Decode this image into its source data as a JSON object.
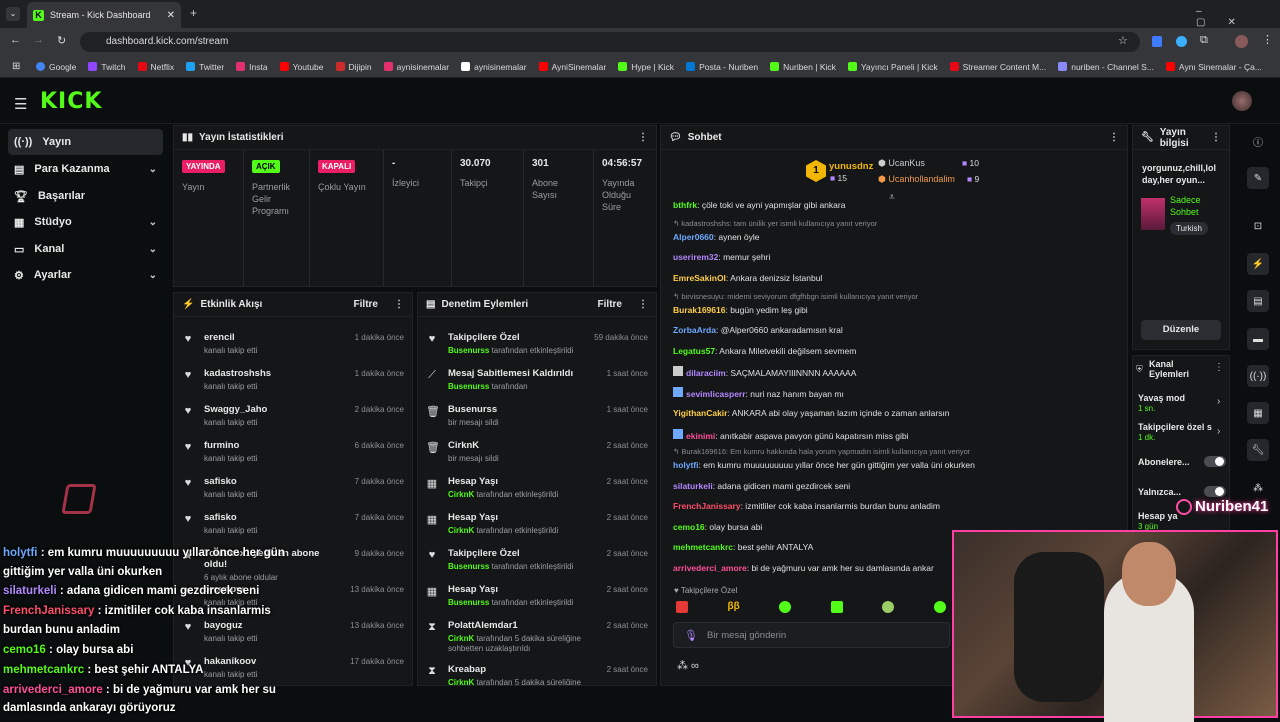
{
  "browser": {
    "tab_title": "Stream - Kick Dashboard",
    "url": "dashboard.kick.com/stream",
    "bookmarks": [
      {
        "label": "Google",
        "color": "#4285f4"
      },
      {
        "label": "Twitch",
        "color": "#9146ff"
      },
      {
        "label": "Netflix",
        "color": "#e50914"
      },
      {
        "label": "Twitter",
        "color": "#1da1f2"
      },
      {
        "label": "Insta",
        "color": "#e1306c"
      },
      {
        "label": "Youtube",
        "color": "#ff0000"
      },
      {
        "label": "Dijipin",
        "color": "#cc2b2b"
      },
      {
        "label": "aynisinemalar",
        "color": "#e1306c"
      },
      {
        "label": "aynisinemalar",
        "color": "#ffffff"
      },
      {
        "label": "AyniSinemalar",
        "color": "#ff0000"
      },
      {
        "label": "Hype | Kick",
        "color": "#53fc18"
      },
      {
        "label": "Posta - Nuriben",
        "color": "#0078d4"
      },
      {
        "label": "Nuriben | Kick",
        "color": "#53fc18"
      },
      {
        "label": "Yayıncı Paneli | Kick",
        "color": "#53fc18"
      },
      {
        "label": "Streamer Content M...",
        "color": "#e50914"
      },
      {
        "label": "nuriben - Channel S...",
        "color": "#8a8aff"
      },
      {
        "label": "Aynı Sinemalar - Ça...",
        "color": "#ff0000"
      }
    ]
  },
  "nav": {
    "items": [
      {
        "label": "Yayın",
        "icon": "broadcast-icon"
      },
      {
        "label": "Para Kazanma",
        "icon": "money-icon"
      },
      {
        "label": "Başarılar",
        "icon": "trophy-icon"
      },
      {
        "label": "Stüdyo",
        "icon": "studio-icon"
      },
      {
        "label": "Kanal",
        "icon": "channel-icon"
      },
      {
        "label": "Ayarlar",
        "icon": "gear-icon"
      }
    ]
  },
  "stats": {
    "title": "Yayın İstatistikleri",
    "cols": [
      {
        "badge": "YAYINDA",
        "badge_color": "#e91e63",
        "label": "Yayın"
      },
      {
        "badge": "AÇIK",
        "badge_color": "#53fc18",
        "label": "Partnerlik Gelir Programı"
      },
      {
        "badge": "KAPALI",
        "badge_color": "#e91e63",
        "label": "Çoklu Yayın"
      },
      {
        "value": "-",
        "label": "İzleyici"
      },
      {
        "value": "30.070",
        "label": "Takipçi"
      },
      {
        "value": "301",
        "label": "Abone Sayısı"
      },
      {
        "value": "04:56:57",
        "label": "Yayında Olduğu Süre"
      }
    ]
  },
  "activity": {
    "title": "Etkinlik Akışı",
    "filter": "Filtre",
    "items": [
      {
        "name": "erencil",
        "sub": "kanalı takip etti",
        "time": "1 dakika önce"
      },
      {
        "name": "kadastroshshs",
        "sub": "kanalı takip etti",
        "time": "1 dakika önce"
      },
      {
        "name": "Swaggy_Jaho",
        "sub": "kanalı takip etti",
        "time": "2 dakika önce"
      },
      {
        "name": "furmino",
        "sub": "kanalı takip etti",
        "time": "6 dakika önce"
      },
      {
        "name": "safisko",
        "sub": "kanalı takip etti",
        "time": "7 dakika önce"
      },
      {
        "name": "safisko",
        "sub": "kanalı takip etti",
        "time": "7 dakika önce"
      },
      {
        "name": "Tonlexox1 yeniden abone oldu!",
        "sub": "6 aylık abone oldular",
        "time": "9 dakika önce"
      },
      {
        "name": "orcunpw",
        "sub": "kanalı takip etti",
        "time": "13 dakika önce"
      },
      {
        "name": "bayoguz",
        "sub": "kanalı takip etti",
        "time": "13 dakika önce"
      },
      {
        "name": "hakanikoov",
        "sub": "kanalı takip etti",
        "time": "17 dakika önce"
      }
    ]
  },
  "moderation": {
    "title": "Denetim Eylemleri",
    "filter": "Filtre",
    "items": [
      {
        "name": "Takipçilere Özel",
        "user": "Busenurss",
        "rest": " tarafından etkinleştirildi",
        "time": "59 dakika önce",
        "icon": "heart-icon"
      },
      {
        "name": "Mesaj Sabitlemesi Kaldırıldı",
        "user": "Busenurss",
        "rest": " tarafından",
        "time": "1 saat önce",
        "icon": "unpin-icon"
      },
      {
        "name": "Busenurss",
        "user": "",
        "rest": "bir mesajı sildi",
        "time": "1 saat önce",
        "icon": "trash-icon"
      },
      {
        "name": "CirknK",
        "user": "",
        "rest": "bir mesajı sildi",
        "time": "2 saat önce",
        "icon": "trash-icon"
      },
      {
        "name": "Hesap Yaşı",
        "user": "CirknK",
        "rest": " tarafından etkinleştirildi",
        "time": "2 saat önce",
        "icon": "calendar-icon"
      },
      {
        "name": "Hesap Yaşı",
        "user": "CirknK",
        "rest": " tarafından etkinleştirildi",
        "time": "2 saat önce",
        "icon": "calendar-icon"
      },
      {
        "name": "Takipçilere Özel",
        "user": "Busenurss",
        "rest": " tarafından etkinleştirildi",
        "time": "2 saat önce",
        "icon": "heart-icon"
      },
      {
        "name": "Hesap Yaşı",
        "user": "Busenurss",
        "rest": " tarafından etkinleştirildi",
        "time": "2 saat önce",
        "icon": "calendar-icon"
      },
      {
        "name": "PolattAlemdar1",
        "user": "CirknK",
        "rest": " tarafından 5 dakika süreliğine sohbetten uzaklaştırıldı",
        "time": "2 saat önce",
        "icon": "hourglass-icon"
      },
      {
        "name": "Kreabap",
        "user": "CirknK",
        "rest": " tarafından 5 dakika süreliğine sohbetten",
        "time": "2 saat önce",
        "icon": "hourglass-icon"
      }
    ]
  },
  "chat": {
    "title": "Sohbet",
    "top": {
      "first": {
        "name": "yunusdnz",
        "count": "15",
        "rank": "1"
      },
      "second": {
        "name": "UcanKus",
        "count": "10"
      },
      "third": {
        "name": "Ucanhollandalim",
        "count": "9"
      }
    },
    "messages": [
      {
        "type": "msg",
        "user": "bthfrk",
        "color": "#53fc18",
        "text": ": çöle toki ve ayni yapmışlar gibi ankara"
      },
      {
        "type": "reply",
        "text": "↰ kadastroshshs: tam ünilik yer isimli kullanıcıya yanıt veriyor"
      },
      {
        "type": "msg",
        "user": "Alper0660",
        "color": "#6fa8ff",
        "text": ": aynen öyle"
      },
      {
        "type": "msg",
        "user": "userirem32",
        "color": "#b388ff",
        "text": ": memur şehri"
      },
      {
        "type": "msg",
        "user": "EmreSakinOl",
        "color": "#ffcf4a",
        "text": ": Ankara denizsiz İstanbul"
      },
      {
        "type": "reply",
        "text": "↰ birvisnesuyu: midemi seviyorum dfgfhbgn isimli kullanıcıya yanıt veriyor"
      },
      {
        "type": "msg",
        "user": "Burak169616",
        "color": "#ffcf4a",
        "text": ": bugün yedim leş gibi"
      },
      {
        "type": "msg",
        "user": "ZorbaArda",
        "color": "#6fa8ff",
        "text": ": @Alper0660 ankaradamısın kral"
      },
      {
        "type": "msg",
        "user": "Legatus57",
        "color": "#53fc18",
        "text": ": Ankara Miletvekili değilsem sevmem"
      },
      {
        "type": "msg",
        "user": "dilaraciim",
        "color": "#b388ff",
        "text": ": SAÇMALAMAYIIINNNN AAAAAA"
      },
      {
        "type": "msg",
        "user": "sevimlicasperr",
        "color": "#b388ff",
        "text": ": nuri naz hanım bayan mı"
      },
      {
        "type": "msg",
        "user": "YigithanCakir",
        "color": "#ffcf4a",
        "text": ": ANKARA abi olay yaşaman lazım içinde o zaman anlarsın"
      },
      {
        "type": "msg",
        "user": "ekinimi",
        "color": "#ff4f9a",
        "text": ": anıtkabir aspava pavyon günü kapatırsın miss gibi"
      },
      {
        "type": "reply",
        "text": "↰ Burak169616: Em kumru hakkında hala yorum yapmadın isimli kullanıcıya yanıt veriyor"
      },
      {
        "type": "msg",
        "user": "holytfi",
        "color": "#6fa8ff",
        "text": ": em kumru muuuuuuuuu yıllar önce her gün gittiğim yer valla üni okurken"
      },
      {
        "type": "msg",
        "user": "silaturkeli",
        "color": "#b388ff",
        "text": ": adana gidicen mami gezdircek seni"
      },
      {
        "type": "msg",
        "user": "FrenchJanissary",
        "color": "#ff4f6a",
        "text": ": izmitliler cok kaba insanlarmis burdan bunu anladim"
      },
      {
        "type": "msg",
        "user": "cemo16",
        "color": "#53fc18",
        "text": ": olay bursa abi"
      },
      {
        "type": "msg",
        "user": "mehmetcankrc",
        "color": "#53fc18",
        "text": ": best şehir ANTALYA"
      },
      {
        "type": "msg",
        "user": "arrivederci_amore",
        "color": "#ff4f9a",
        "text": ": bi de yağmuru var amk her su damlasında ankar"
      }
    ],
    "mode": "Takipçilere Özel",
    "input_placeholder": "Bir mesaj gönderin"
  },
  "info": {
    "title": "Yayın bilgisi",
    "stream_title": "yorgunuz,chill,lol day,her oyun...",
    "category": "Sadece Sohbet",
    "tag": "Turkish",
    "edit_button": "Düzenle"
  },
  "channel_actions": {
    "title": "Kanal Eylemleri",
    "slow_mode": "Yavaş mod",
    "slow_value": "1 sn.",
    "followers_only": "Takipçilere özel s",
    "followers_value": "1 dk.",
    "subs_only": "Abonelere...",
    "only": "Yalnızca...",
    "account_age": "Hesap ya",
    "account_value": "3 gün"
  },
  "overlay": {
    "watermark": "Nuriben41",
    "lines": [
      {
        "user": "holytfi",
        "color": "#6fa8ff",
        "text": " : em kumru muuuuuuuuu yıllar önce her gün"
      },
      {
        "user": "",
        "color": "#ffffff",
        "text": "gittiğim yer valla üni okurken"
      },
      {
        "user": "silaturkeli",
        "color": "#b388ff",
        "text": " : adana gidicen mami gezdircek seni"
      },
      {
        "user": "FrenchJanissary",
        "color": "#ff4f6a",
        "text": " : izmitliler cok kaba insanlarmis"
      },
      {
        "user": "",
        "color": "#ffffff",
        "text": "burdan bunu anladim"
      },
      {
        "user": "cemo16",
        "color": "#53fc18",
        "text": " : olay bursa abi"
      },
      {
        "user": "mehmetcankrc",
        "color": "#53fc18",
        "text": " : best şehir ANTALYA"
      },
      {
        "user": "arrivederci_amore",
        "color": "#ff4f9a",
        "text": " : bi de yağmuru var amk her su"
      },
      {
        "user": "",
        "color": "#ffffff",
        "text": "damlasında ankarayı görüyoruz"
      }
    ]
  }
}
